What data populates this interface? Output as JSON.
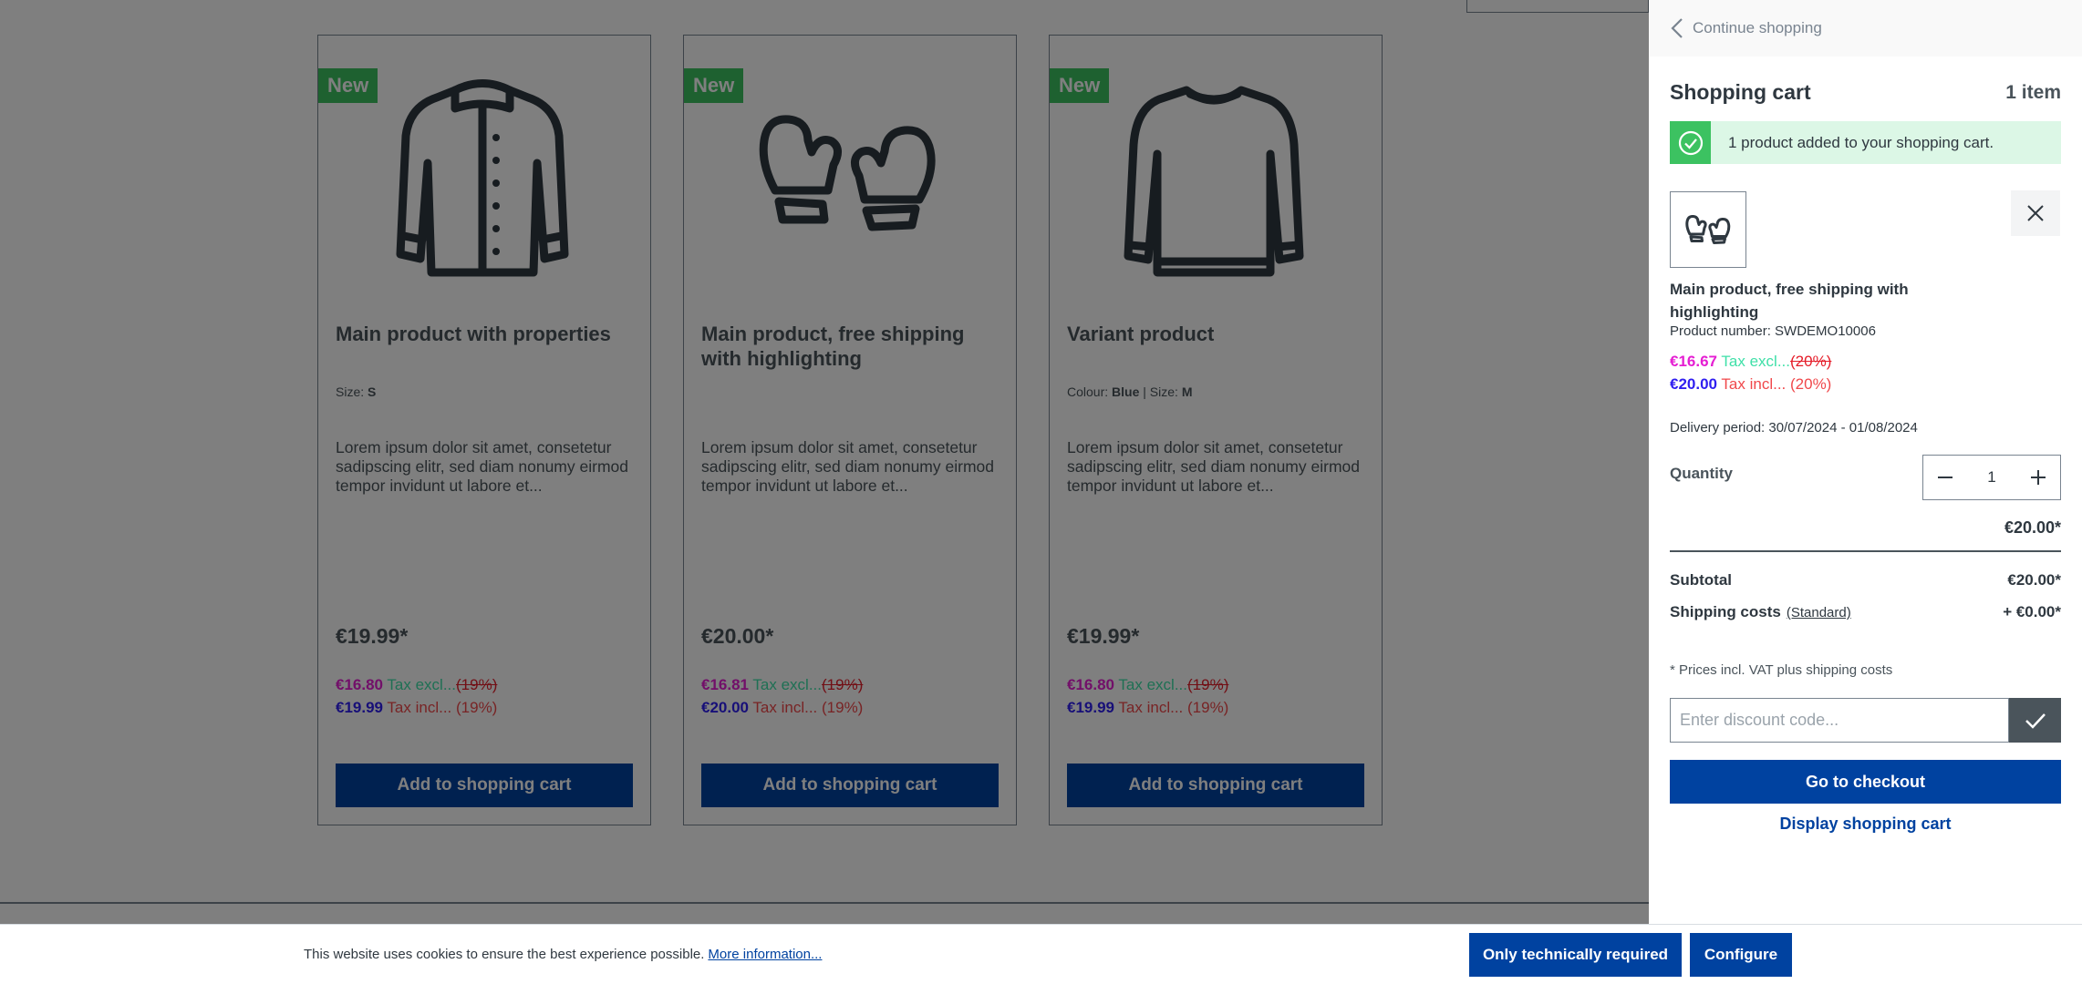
{
  "products": [
    {
      "badge": "New",
      "image": "jacket-icon",
      "name": "Main product with properties",
      "props": [
        {
          "label": "Size:",
          "value": "S"
        }
      ],
      "description": "Lorem ipsum dolor sit amet, consetetur sadipscing elitr, sed diam nonumy eirmod tempor invidunt ut labore et...",
      "price": "€19.99*",
      "net_price": "€16.80",
      "tax_excl": "Tax excl...",
      "tax_excl_rate": "(19%)",
      "gross_price": "€19.99",
      "tax_incl": "Tax incl... (19%)",
      "button": "Add to shopping cart"
    },
    {
      "badge": "New",
      "image": "mittens-icon",
      "name": "Main product, free shipping with highlighting",
      "props": [],
      "description": "Lorem ipsum dolor sit amet, consetetur sadipscing elitr, sed diam nonumy eirmod tempor invidunt ut labore et...",
      "price": "€20.00*",
      "net_price": "€16.81",
      "tax_excl": "Tax excl...",
      "tax_excl_rate": "(19%)",
      "gross_price": "€20.00",
      "tax_incl": "Tax incl... (19%)",
      "button": "Add to shopping cart"
    },
    {
      "badge": "New",
      "image": "sweater-icon",
      "name": "Variant product",
      "props": [
        {
          "label": "Colour:",
          "value": "Blue"
        },
        {
          "label": "Size:",
          "value": "M"
        }
      ],
      "description": "Lorem ipsum dolor sit amet, consetetur sadipscing elitr, sed diam nonumy eirmod tempor invidunt ut labore et...",
      "price": "€19.99*",
      "net_price": "€16.80",
      "tax_excl": "Tax excl...",
      "tax_excl_rate": "(19%)",
      "gross_price": "€19.99",
      "tax_incl": "Tax incl... (19%)",
      "button": "Add to shopping cart"
    }
  ],
  "cart": {
    "continue": "Continue shopping",
    "title": "Shopping cart",
    "count": "1 item",
    "alert": "1 product added to your shopping cart.",
    "item": {
      "image": "mittens-icon",
      "name": "Main product, free shipping with highlighting",
      "number": "Product number: SWDEMO10006",
      "net_price": "€16.67",
      "tax_excl": "Tax excl...",
      "tax_excl_rate": "(20%)",
      "gross_price": "€20.00",
      "tax_incl": "Tax incl... (20%)",
      "delivery": "Delivery period: 30/07/2024 - 01/08/2024",
      "quantity_label": "Quantity",
      "quantity": "1",
      "total": "€20.00*"
    },
    "subtotal_label": "Subtotal",
    "subtotal": "€20.00*",
    "shipping_label": "Shipping costs",
    "shipping_method": "(Standard)",
    "shipping": "+ €0.00*",
    "vat_note": "* Prices incl. VAT plus shipping costs",
    "discount_placeholder": "Enter discount code...",
    "checkout": "Go to checkout",
    "display_cart": "Display shopping cart"
  },
  "cookie": {
    "text": "This website uses cookies to ensure the best experience possible.",
    "link": "More information...",
    "btn_required": "Only technically required",
    "btn_configure": "Configure"
  },
  "colors": {
    "primary": "#0042a0",
    "success": "#3cc261",
    "net_price": "#e51ed2",
    "gross_price": "#2f1ef0"
  }
}
